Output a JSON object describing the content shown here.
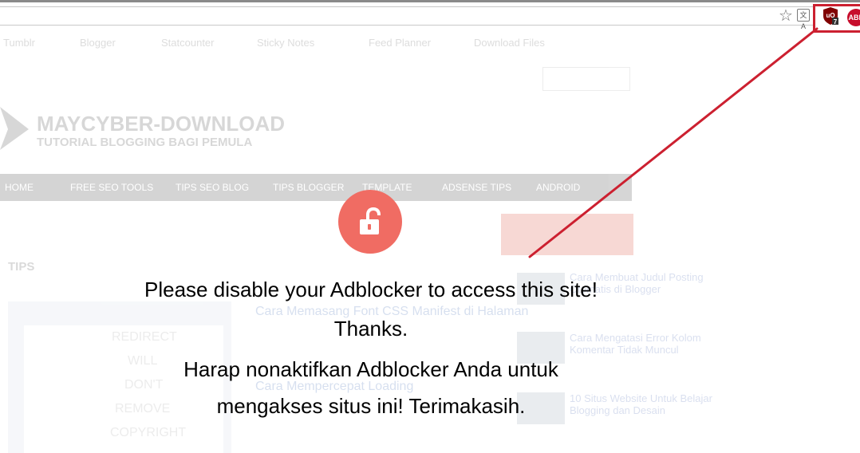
{
  "browser": {
    "extensions": {
      "ublock_label": "uO",
      "ublock_badge": "7",
      "abp_label": "ABP"
    },
    "translate_label": "文A"
  },
  "site": {
    "bookmarks": [
      "Tumblr",
      "Blogger",
      "Statcounter",
      "Sticky Notes",
      "Feed Planner",
      "Download Files"
    ],
    "logo_title": "MAYCYBER-DOWNLOAD",
    "logo_subtitle": "TUTORIAL BLOGGING BAGI PEMULA",
    "nav": [
      "HOME",
      "FREE SEO TOOLS",
      "TIPS SEO BLOG",
      "TIPS BLOGGER",
      "TEMPLATE",
      "ADSENSE TIPS",
      "ANDROID"
    ],
    "section_label": "TIPS",
    "card_text": [
      "REDIRECT",
      "WILL",
      "DON'T",
      "REMOVE",
      "COPYRIGHT"
    ],
    "post_titles": [
      "Cara Memasang Font CSS Manifest di Halaman",
      "Cara Mempercepat Loading"
    ],
    "side_posts": [
      "Cara Membuat Judul Posting Otomatis di Blogger",
      "Cara Mengatasi Error Kolom Komentar Tidak Muncul",
      "10 Situs Website Untuk Belajar Blogging dan Desain"
    ]
  },
  "overlay": {
    "lines": [
      "Please disable your Adblocker to access this site!",
      "Thanks.",
      "Harap nonaktifkan Adblocker Anda untuk",
      "mengakses situs ini! Terimakasih."
    ]
  },
  "colors": {
    "accent_red": "#cc2030",
    "lock_circle": "#f06c63",
    "abp_red": "#c70d2c"
  }
}
